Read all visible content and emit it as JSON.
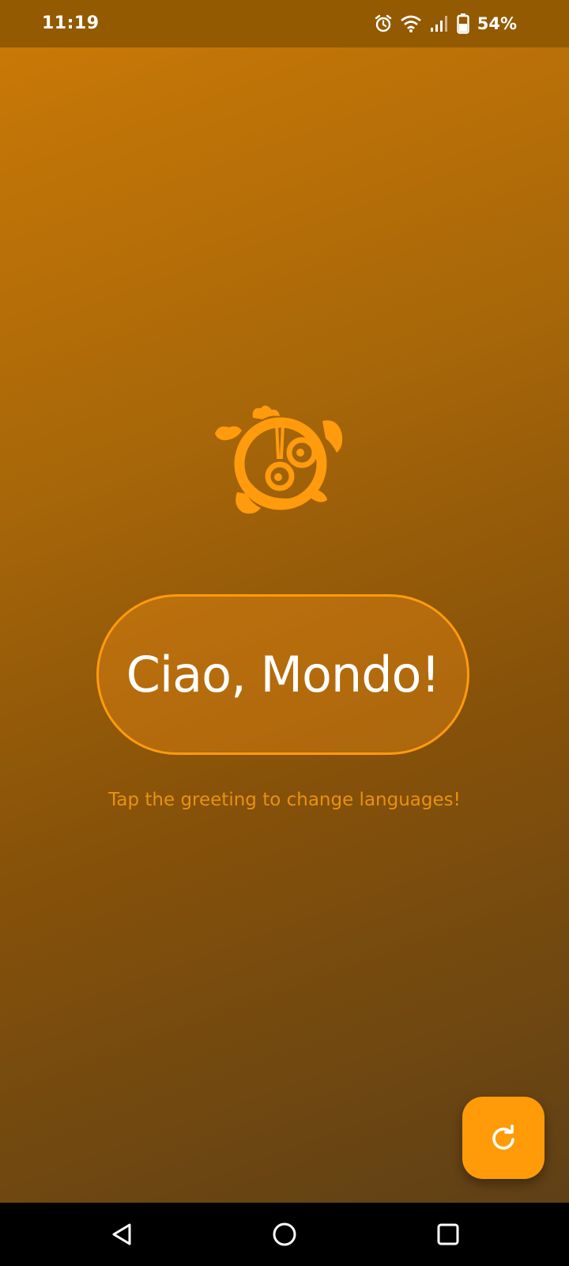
{
  "status_bar": {
    "time": "11:19",
    "battery_percent": "54%",
    "icons": [
      "alarm-icon",
      "wifi-icon",
      "signal-icon",
      "battery-icon"
    ]
  },
  "logo": {
    "icon": "flutter-bird-logo",
    "color": "#ff9b0d"
  },
  "greeting": {
    "text": "Ciao, Mondo!"
  },
  "hint": {
    "text": "Tap the greeting to change languages!"
  },
  "fab": {
    "icon": "refresh-icon",
    "color": "#ff9b08"
  },
  "navigation": {
    "buttons": [
      "back-icon",
      "home-icon",
      "recents-icon"
    ]
  },
  "colors": {
    "accent": "#ff9b0d",
    "status_bar": "#935a02"
  }
}
